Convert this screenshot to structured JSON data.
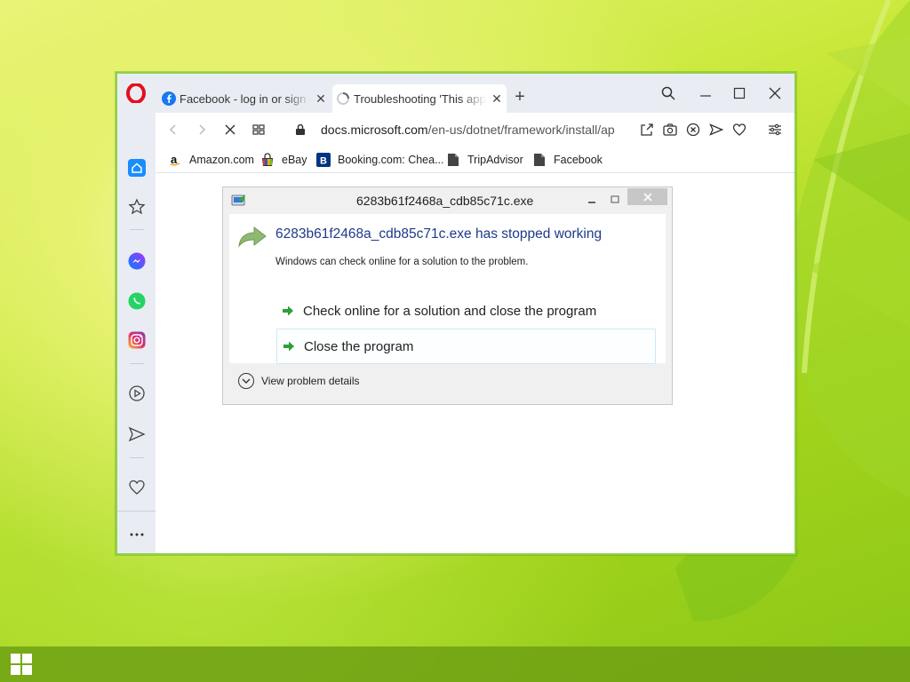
{
  "browser": {
    "tabs": [
      {
        "title": "Facebook - log in or sign up",
        "icon": "facebook-icon"
      },
      {
        "title": "Troubleshooting 'This application could not be started'",
        "icon": "loading-spinner-icon"
      }
    ],
    "address_bar": {
      "url_host": "docs.microsoft.com",
      "url_path": "/en-us/dotnet/framework/install/application-not-started"
    },
    "bookmarks": [
      {
        "label": "Amazon.com",
        "icon": "amazon-icon"
      },
      {
        "label": "eBay",
        "icon": "ebay-icon"
      },
      {
        "label": "Booking.com: Chea...",
        "icon": "booking-icon"
      },
      {
        "label": "TripAdvisor",
        "icon": "page-icon"
      },
      {
        "label": "Facebook",
        "icon": "page-icon"
      }
    ],
    "sidebar_icons": [
      "home-icon",
      "speed-dial-icon",
      "messenger-icon",
      "whatsapp-icon",
      "instagram-icon",
      "player-icon",
      "flow-icon",
      "heart-icon",
      "more-icon"
    ]
  },
  "dialog": {
    "title": "6283b61f2468a_cdb85c71c.exe",
    "heading": "6283b61f2468a_cdb85c71c.exe has stopped working",
    "description": "Windows can check online for a solution to the problem.",
    "option_check_online": "Check online for a solution and close the program",
    "option_close": "Close the program",
    "details_label": "View problem details"
  },
  "colors": {
    "accent_blue": "#1e3a8a",
    "window_border": "#8fd148",
    "opera_red": "#e3101c"
  }
}
